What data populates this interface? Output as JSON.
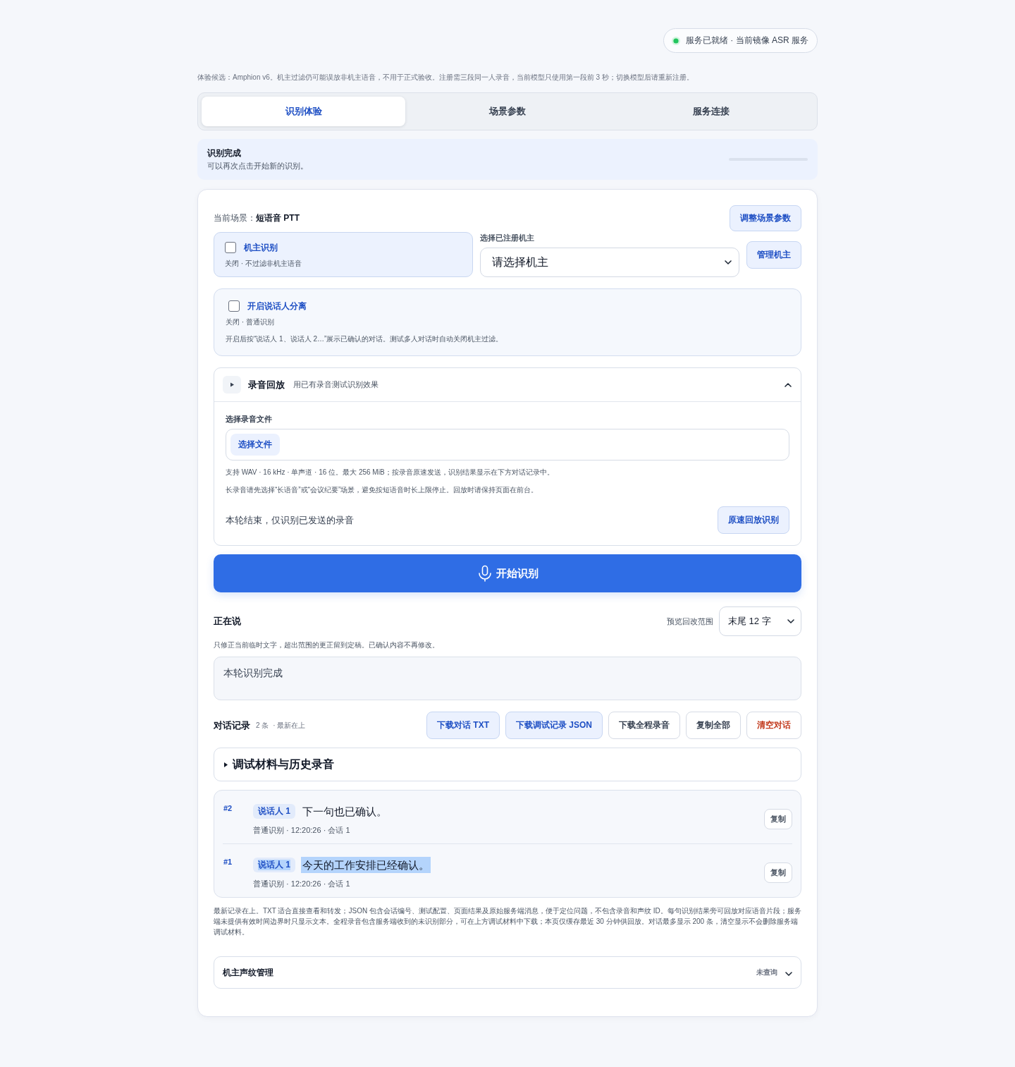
{
  "status": {
    "text": "服务已就绪 · 当前镜像 ASR 服务",
    "online": true
  },
  "notice": "体验候选：Amphion v6。机主过滤仍可能误放非机主语音，不用于正式验收。注册需三段同一人录音，当前模型只使用第一段前 3 秒；切换模型后请重新注册。",
  "tabs": [
    {
      "label": "识别体验",
      "selected": true
    },
    {
      "label": "场景参数",
      "selected": false
    },
    {
      "label": "服务连接",
      "selected": false
    }
  ],
  "status_banner": {
    "title": "识别完成",
    "detail": "可以再次点击开始新的识别。",
    "level": 0
  },
  "scene": {
    "label": "当前场景：",
    "value": "短语音 PTT",
    "button": "调整场景参数"
  },
  "owner_filter": {
    "label": "机主识别",
    "checked": false,
    "detail": "关闭 · 不过滤非机主语音"
  },
  "owner_select": {
    "label": "选择已注册机主",
    "value": "请选择机主",
    "button": "管理机主"
  },
  "diarization": {
    "label": "开启说话人分离",
    "checked": false,
    "detail": "关闭 · 普通识别",
    "description": "开启后按“说话人 1、说话人 2…”展示已确认的对话。测试多人对话时自动关闭机主过滤。"
  },
  "playback": {
    "title": "录音回放",
    "subtitle": "用已有录音测试识别效果",
    "expanded": true,
    "file_label": "选择录音文件",
    "file_button": "选择文件",
    "hints": [
      "支持 WAV · 16 kHz · 单声道 · 16 位。最大 256 MiB；按录音原速发送，识别结果显示在下方对话记录中。",
      "长录音请先选择“长语音”或“会议纪要”场景，避免按短语音时长上限停止。回放时请保持页面在前台。"
    ],
    "status": "本轮结束，仅识别已发送的录音",
    "replay_button": "原速回放识别"
  },
  "start_button": "开始识别",
  "live": {
    "title": "正在说",
    "range_label": "预览回改范围",
    "range_value": "末尾 12 字",
    "hint": "只修正当前临时文字，超出范围的更正留到定稿。已确认内容不再修改。",
    "text": "本轮识别完成"
  },
  "dialog": {
    "title": "对话记录",
    "count": "2 条",
    "order": "· 最新在上",
    "actions": [
      {
        "label": "下载对话 TXT",
        "kind": "primary"
      },
      {
        "label": "下载调试记录 JSON",
        "kind": "primary"
      },
      {
        "label": "下载全程录音",
        "kind": "plain"
      },
      {
        "label": "复制全部",
        "kind": "plain"
      },
      {
        "label": "清空对话",
        "kind": "danger"
      }
    ]
  },
  "debug_materials": {
    "title": "调试材料与历史录音",
    "expanded": false
  },
  "transcripts": [
    {
      "index": "#2",
      "speaker": "说话人 1",
      "text": "下一句也已确认。",
      "meta": "普通识别 · 12:20:26 · 会话 1",
      "copy": "复制",
      "highlighted": false
    },
    {
      "index": "#1",
      "speaker": "说话人 1",
      "text": "今天的工作安排已经确认。",
      "meta": "普通识别 · 12:20:26 · 会话 1",
      "copy": "复制",
      "highlighted": true
    }
  ],
  "footnote": "最新记录在上。TXT 适合直接查看和转发；JSON 包含会话编号、测试配置、页面结果及原始服务端消息，便于定位问题，不包含录音和声纹 ID。每句识别结果旁可回放对应语音片段；服务端未提供有效时间边界时只显示文本。全程录音包含服务端收到的未识别部分，可在上方调试材料中下载；本页仅缓存最近 30 分钟供回放。对话最多显示 200 条，清空显示不会删除服务端调试材料。",
  "voiceprint": {
    "title": "机主声纹管理",
    "status": "未查询",
    "expanded": false
  }
}
